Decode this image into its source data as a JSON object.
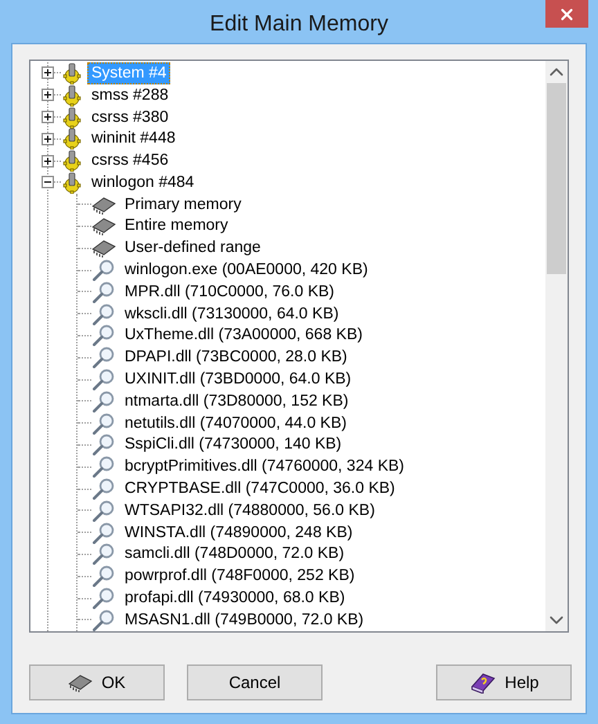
{
  "window": {
    "title": "Edit Main Memory"
  },
  "tree": [
    {
      "kind": "process",
      "label": "System #4",
      "expanded": false,
      "selected": true
    },
    {
      "kind": "process",
      "label": "smss #288",
      "expanded": false,
      "selected": false
    },
    {
      "kind": "process",
      "label": "csrss #380",
      "expanded": false,
      "selected": false
    },
    {
      "kind": "process",
      "label": "wininit #448",
      "expanded": false,
      "selected": false
    },
    {
      "kind": "process",
      "label": "csrss #456",
      "expanded": false,
      "selected": false
    },
    {
      "kind": "process",
      "label": "winlogon #484",
      "expanded": true,
      "selected": false,
      "children": [
        {
          "kind": "memory",
          "label": "Primary memory",
          "selected": false
        },
        {
          "kind": "memory",
          "label": "Entire memory",
          "selected": false
        },
        {
          "kind": "memory",
          "label": "User-defined range",
          "selected": false
        },
        {
          "kind": "module",
          "label": "winlogon.exe (00AE0000, 420 KB)",
          "selected": false
        },
        {
          "kind": "module",
          "label": "MPR.dll (710C0000, 76.0 KB)",
          "selected": false
        },
        {
          "kind": "module",
          "label": "wkscli.dll (73130000, 64.0 KB)",
          "selected": false
        },
        {
          "kind": "module",
          "label": "UxTheme.dll (73A00000, 668 KB)",
          "selected": false
        },
        {
          "kind": "module",
          "label": "DPAPI.dll (73BC0000, 28.0 KB)",
          "selected": false
        },
        {
          "kind": "module",
          "label": "UXINIT.dll (73BD0000, 64.0 KB)",
          "selected": false
        },
        {
          "kind": "module",
          "label": "ntmarta.dll (73D80000, 152 KB)",
          "selected": false
        },
        {
          "kind": "module",
          "label": "netutils.dll (74070000, 44.0 KB)",
          "selected": false
        },
        {
          "kind": "module",
          "label": "SspiCli.dll (74730000, 140 KB)",
          "selected": false
        },
        {
          "kind": "module",
          "label": "bcryptPrimitives.dll (74760000, 324 KB)",
          "selected": false
        },
        {
          "kind": "module",
          "label": "CRYPTBASE.dll (747C0000, 36.0 KB)",
          "selected": false
        },
        {
          "kind": "module",
          "label": "WTSAPI32.dll (74880000, 56.0 KB)",
          "selected": false
        },
        {
          "kind": "module",
          "label": "WINSTA.dll (74890000, 248 KB)",
          "selected": false
        },
        {
          "kind": "module",
          "label": "samcli.dll (748D0000, 72.0 KB)",
          "selected": false
        },
        {
          "kind": "module",
          "label": "powrprof.dll (748F0000, 252 KB)",
          "selected": false
        },
        {
          "kind": "module",
          "label": "profapi.dll (74930000, 68.0 KB)",
          "selected": false
        },
        {
          "kind": "module",
          "label": "MSASN1.dll (749B0000, 72.0 KB)",
          "selected": false
        }
      ]
    }
  ],
  "buttons": [
    {
      "kind": "ok",
      "label": "OK"
    },
    {
      "kind": "cancel",
      "label": "Cancel"
    },
    {
      "kind": "help",
      "label": "Help"
    }
  ]
}
